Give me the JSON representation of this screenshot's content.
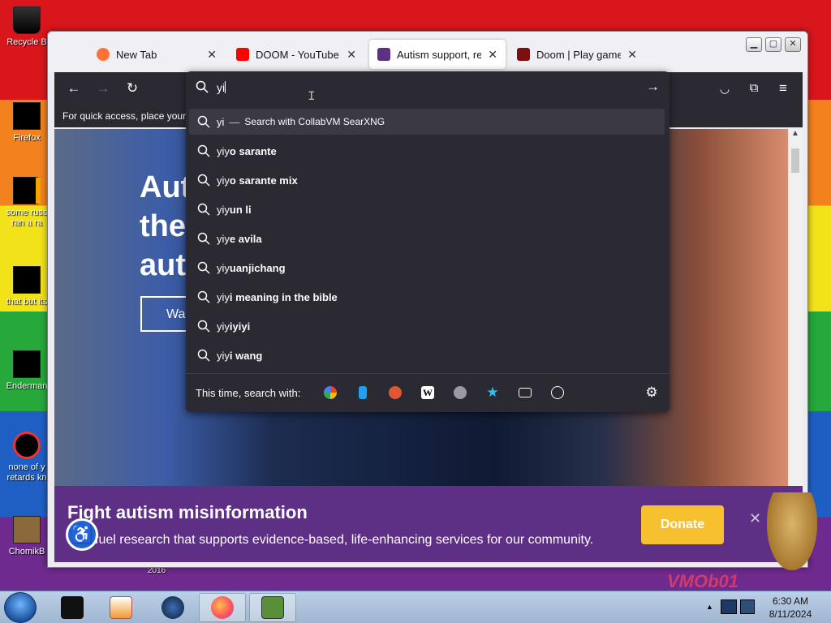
{
  "desktop": {
    "icons": [
      {
        "label": "Recycle B",
        "name": "recycle-bin-desktop-icon"
      },
      {
        "label": "Firefox",
        "name": "firefox-desktop-icon"
      },
      {
        "label": "some russ",
        "label2": "ran a ra",
        "name": "document-desktop-icon"
      },
      {
        "label": "that but its",
        "name": "folder-desktop-icon"
      },
      {
        "label": "Enderman",
        "name": "enderman-desktop-icon"
      },
      {
        "label": "none of y",
        "label2": "retards kn",
        "name": "chrome-desktop-icon"
      },
      {
        "label": "ChomikB",
        "name": "chomik-desktop-icon"
      }
    ],
    "background_note": "2016",
    "corner_text": "VMOb01"
  },
  "browser": {
    "tabs": [
      {
        "title": "New Tab",
        "icon": "firefox-icon",
        "fav_color": "#ff7139"
      },
      {
        "title": "DOOM - YouTube",
        "icon": "youtube-icon",
        "fav_color": "#ff0000"
      },
      {
        "title": "Autism support, reso",
        "icon": "puzzle-icon",
        "fav_color": "#5d2f85"
      },
      {
        "title": "Doom | Play game on",
        "icon": "doom-icon",
        "fav_color": "#7a1010"
      }
    ],
    "bookmarks_hint": "For quick access, place your b",
    "urlbar": {
      "query": "yi",
      "suggestions": [
        {
          "prefix": "yi",
          "rest": "",
          "engine": "Search with CollabVM SearXNG",
          "selected": true
        },
        {
          "prefix": "yiy",
          "rest": "o sarante"
        },
        {
          "prefix": "yiy",
          "rest": "o sarante mix"
        },
        {
          "prefix": "yiy",
          "rest": "un li"
        },
        {
          "prefix": "yiy",
          "rest": "e avila"
        },
        {
          "prefix": "yiy",
          "rest": "uanjichang"
        },
        {
          "prefix": "yiy",
          "rest": "i meaning in the bible"
        },
        {
          "prefix": "yiy",
          "rest": "iyiyi"
        },
        {
          "prefix": "yiy",
          "rest": "i wang"
        }
      ],
      "oneoff_label": "This time, search with:",
      "engines": [
        "google-icon",
        "bing-icon",
        "duckduckgo-icon",
        "wikipedia-icon",
        "searx-icon",
        "bookmarks-star-icon",
        "tabs-icon",
        "history-icon"
      ]
    }
  },
  "page": {
    "hero_line1": "Aut",
    "hero_line2": "the",
    "hero_line3": "aut",
    "hero_button": "Wa",
    "banner_title": "Fight autism misinformation",
    "banner_text": "fuel research that supports evidence-based, life-enhancing services for our community.",
    "donate_label": "Donate"
  },
  "taskbar": {
    "time": "6:30 AM",
    "date": "8/11/2024",
    "items": [
      "cmd-icon",
      "media-player-icon",
      "network-globe-icon",
      "firefox-taskbar-icon",
      "box-game-icon"
    ],
    "colors": {
      "accent": "#1f64c8",
      "donate": "#f6c02e",
      "banner": "#5d2f85"
    }
  }
}
